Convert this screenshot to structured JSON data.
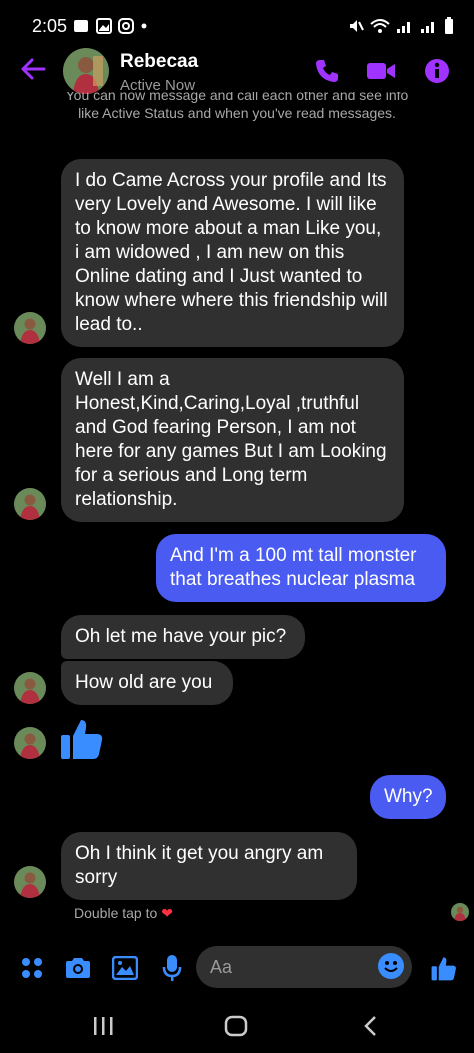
{
  "status_bar": {
    "time": "2:05"
  },
  "header": {
    "name": "Rebecaa",
    "status": "Active Now"
  },
  "system_note": {
    "text": "You can now message and call each other and see info like Active Status and when you've read messages."
  },
  "messages": {
    "m1": "I do Came Across your profile and Its very Lovely and Awesome. I will like to know more about a man Like you, i am widowed , I am new on this Online dating  and I Just wanted to know where where this friendship will lead to..",
    "m2": "Well I am a Honest,Kind,Caring,Loyal ,truthful and God fearing Person, I am not here for any  games But I am Looking for a serious and Long term relationship.",
    "m3": "And I'm a 100 mt tall monster that breathes nuclear plasma",
    "m4": "Oh let me have your pic?",
    "m5": "How old are you",
    "m6": "Why?",
    "m7": "Oh  I think  it get you angry am sorry"
  },
  "seen": {
    "text": "Double tap to"
  },
  "composer": {
    "placeholder": "Aa"
  },
  "colors": {
    "accent": "#a033ff",
    "blue": "#3a8dff",
    "outgoing": "#4a5bf2",
    "incoming": "#303030"
  },
  "icons": [
    "back-arrow-icon",
    "phone-icon",
    "video-icon",
    "info-icon",
    "apps-icon",
    "camera-icon",
    "image-icon",
    "microphone-icon",
    "emoji-icon",
    "thumbs-up-icon"
  ]
}
